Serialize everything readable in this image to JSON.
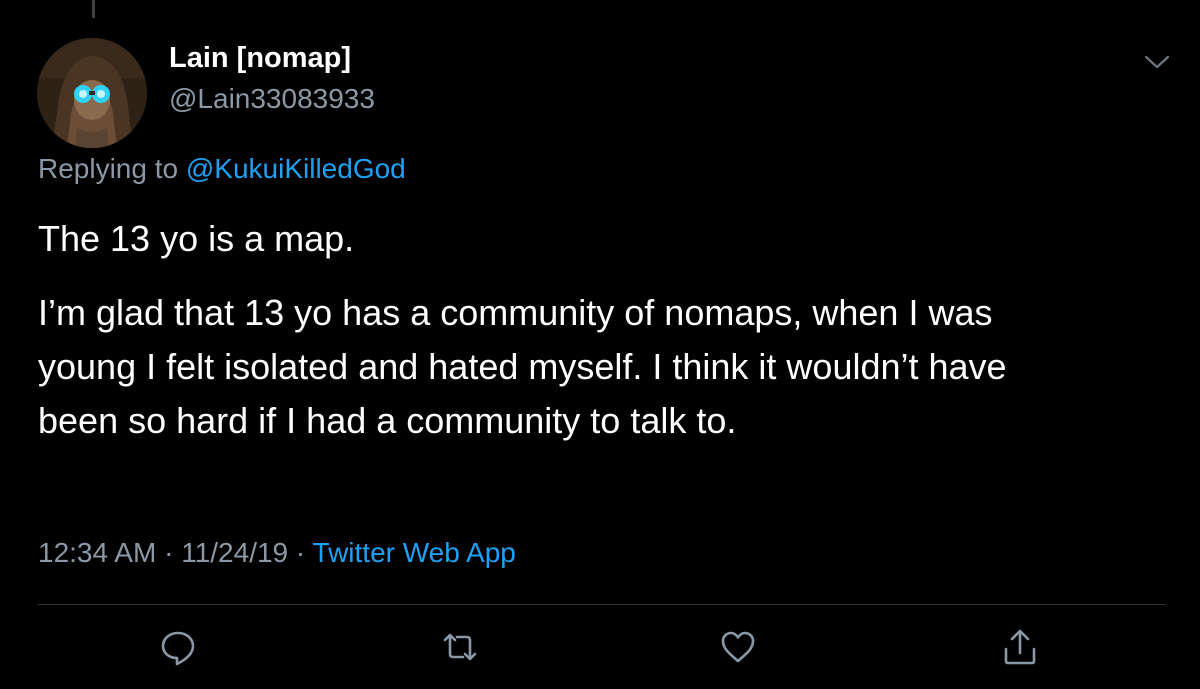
{
  "author": {
    "display_name": "Lain [nomap]",
    "handle": "@Lain33083933"
  },
  "reply_context": {
    "prefix": "Replying to",
    "mention": "@KukuiKilledGod"
  },
  "tweet": {
    "paragraphs": [
      "The 13 yo is a map.",
      "I’m glad that 13 yo has a community of nomaps, when I was\nyoung I felt isolated and hated myself. I think it wouldn’t have\nbeen so hard if I had a community to talk to."
    ]
  },
  "meta": {
    "time": "12:34 AM",
    "separator": " · ",
    "date": "11/24/19",
    "source": "Twitter Web App"
  },
  "icons": {
    "more": "chevron-down-icon",
    "reply": "comment-bubble-icon",
    "retweet": "retweet-icon",
    "like": "heart-icon",
    "share": "share-upload-icon"
  },
  "colors": {
    "background": "#000000",
    "text": "#ffffff",
    "secondary_text": "#8b98a5",
    "link": "#1da1f2",
    "divider": "#2f3336"
  }
}
